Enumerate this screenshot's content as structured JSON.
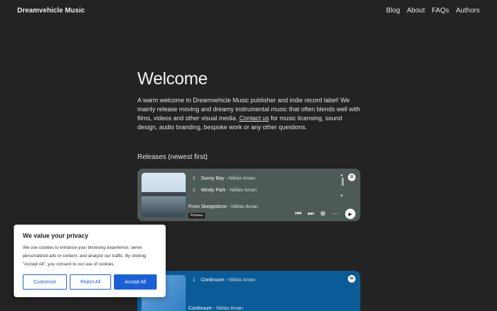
{
  "header": {
    "brand": "Dreamvehicle Music",
    "nav": [
      "Blog",
      "About",
      "FAQs",
      "Authors"
    ]
  },
  "main": {
    "title": "Welcome",
    "intro_before": "A warm welcome to Dreamvehicle Music publisher and indie record label! We mainly release moving and dreamy instrumental music that often blends well with films, videos and other visual media. ",
    "intro_link": "Contact us",
    "intro_after": " for music licensing, sound design, audio branding, bespoke work or any other questions.",
    "releases_heading": "Releases (newest first)"
  },
  "embed1": {
    "tracks": [
      {
        "num": "1",
        "title": "Sunny Bay",
        "artist": " - Niklas Aman"
      },
      {
        "num": "2",
        "title": "Windy Park",
        "artist": " - Niklas Aman"
      }
    ],
    "from_text": "From Skeppsbron",
    "from_artist": " - Niklas Aman",
    "preview": "Preview",
    "color": "#4d5a57"
  },
  "embed2": {
    "tracks": [
      {
        "num": "1",
        "title": "Continuum",
        "artist": " - Niklas Aman"
      }
    ],
    "album_title": "Continuum",
    "album_artist": " - Niklas Aman",
    "color": "#0b5b98"
  },
  "cookie": {
    "title": "We value your privacy",
    "text": "We use cookies to enhance your browsing experience, serve personalized ads or content, and analyze our traffic. By clicking \"Accept All\", you consent to our use of cookies.",
    "customize": "Customize",
    "reject": "Reject All",
    "accept": "Accept All",
    "accent": "#1a5fd6"
  },
  "icons": {
    "spotify": "spotify-icon",
    "prev": "skip-back-icon",
    "next": "skip-forward-icon",
    "add": "add-circle-icon",
    "more": "more-icon",
    "play": "play-icon"
  }
}
